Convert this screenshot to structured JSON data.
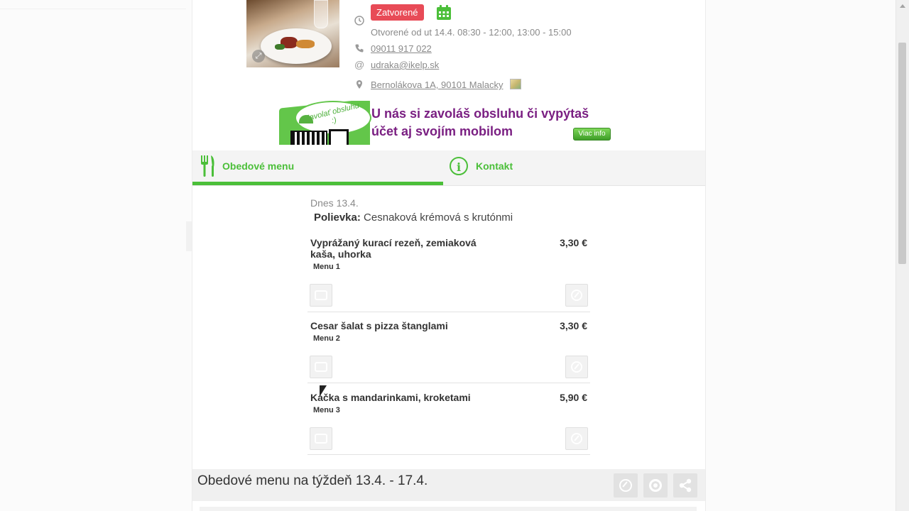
{
  "restaurant": {
    "status_badge": "Zatvorené",
    "opening_hours": "Otvorené od ut 14.4. 08:30 - 12:00, 13:00 - 15:00",
    "phone": "09011 917 022",
    "email": "udraka@ikelp.sk",
    "address": "Bernolákova 1A, 90101 Malacky"
  },
  "banner": {
    "bubble_text": "Zavolať obsluhu :)",
    "headline_line1": "U nás si zavoláš obsluhu či vypýtaš",
    "headline_line2": "účet aj svojím mobilom",
    "more_button": "Viac info"
  },
  "tabs": [
    {
      "label": "Obedové menu",
      "active": true
    },
    {
      "label": "Kontakt",
      "active": false
    }
  ],
  "menu": {
    "date": "Dnes 13.4.",
    "soup_label": "Polievka:",
    "soup_name": "Cesnaková krémová s krutónmi",
    "dishes": [
      {
        "name": "Vyprážaný kurací rezeň, zemiaková kaša, uhorka",
        "price": "3,30 €",
        "tag": "Menu 1"
      },
      {
        "name": "Cesar šalat s pizza štanglami",
        "price": "3,30 €",
        "tag": "Menu 2"
      },
      {
        "name": "Kačka s mandarinkami, kroketami",
        "price": "5,90 €",
        "tag": "Menu 3"
      }
    ]
  },
  "week_bar": {
    "title": "Obedové menu na týždeň 13.4. - 17.4."
  },
  "colors": {
    "accent_green": "#4bbf39",
    "closed_red": "#e84b57",
    "banner_purple": "#7a1f82"
  }
}
